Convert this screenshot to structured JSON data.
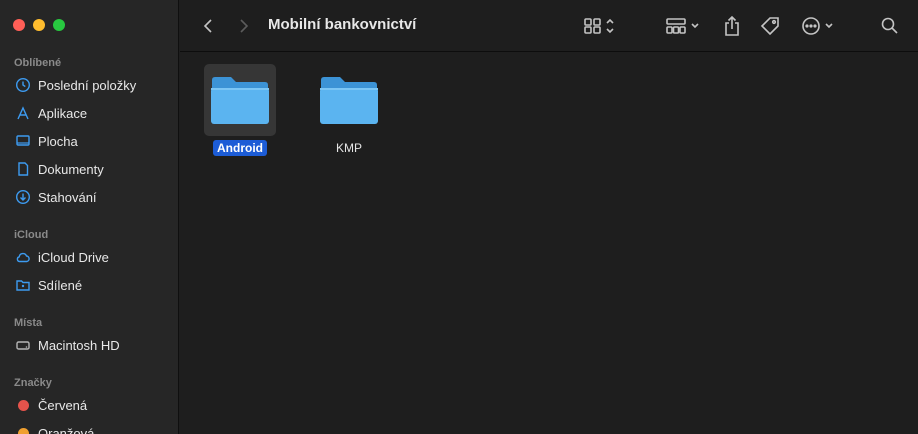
{
  "window": {
    "title": "Mobilní bankovnictví"
  },
  "sidebar": {
    "favorites_title": "Oblíbené",
    "favorites": [
      {
        "label": "Poslední položky",
        "icon": "clock-icon"
      },
      {
        "label": "Aplikace",
        "icon": "apps-icon"
      },
      {
        "label": "Plocha",
        "icon": "desktop-icon"
      },
      {
        "label": "Dokumenty",
        "icon": "document-icon"
      },
      {
        "label": "Stahování",
        "icon": "download-icon"
      }
    ],
    "icloud_title": "iCloud",
    "icloud": [
      {
        "label": "iCloud Drive",
        "icon": "cloud-icon"
      },
      {
        "label": "Sdílené",
        "icon": "shared-folder-icon"
      }
    ],
    "locations_title": "Místa",
    "locations": [
      {
        "label": "Macintosh HD",
        "icon": "disk-icon"
      }
    ],
    "tags_title": "Značky",
    "tags": [
      {
        "label": "Červená",
        "color": "#e5534b"
      },
      {
        "label": "Oranžová",
        "color": "#f0a030"
      }
    ]
  },
  "toolbar": {
    "back_icon": "chevron-left-icon",
    "forward_icon": "chevron-right-icon",
    "view_icon": "grid-icon",
    "group_icon": "group-icon",
    "share_icon": "share-icon",
    "tag_icon": "tag-icon",
    "more_icon": "ellipsis-icon",
    "search_icon": "search-icon"
  },
  "content": {
    "folders": [
      {
        "name": "Android",
        "selected": true
      },
      {
        "name": "KMP",
        "selected": false
      }
    ]
  },
  "colors": {
    "accent": "#1c5cd6",
    "folder_blue": "#4aa8e8"
  }
}
